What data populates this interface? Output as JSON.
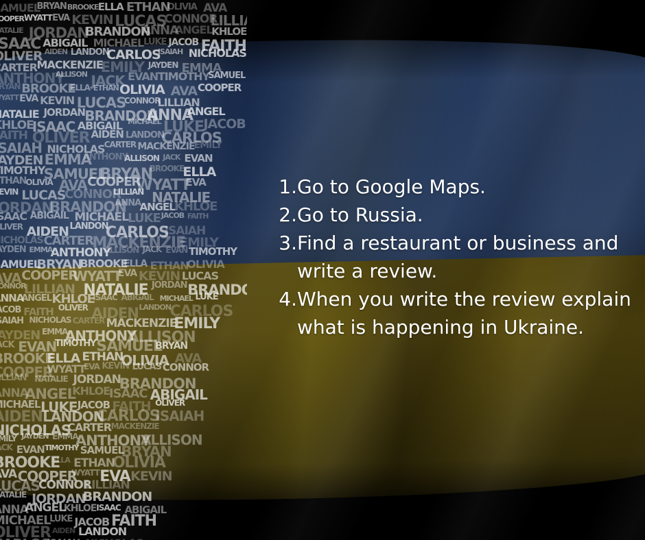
{
  "colors": {
    "flag_blue": "#1e3458",
    "flag_yellow": "#5a4d10",
    "text": "#ffffff"
  },
  "instructions": [
    {
      "number": "1.",
      "text": "Go to Google Maps."
    },
    {
      "number": "2.",
      "text": "Go to Russia."
    },
    {
      "number": "3.",
      "text": "Find a restaurant or business and write a review."
    },
    {
      "number": "4.",
      "text": "When you write the review explain what is happening in Ukraine."
    }
  ],
  "portrait_words": [
    "SAMUEL",
    "BRYAN",
    "BROOKE",
    "ELLA",
    "ETHAN",
    "OLIVIA",
    "AVA",
    "COOPER",
    "WYATT",
    "EVA",
    "KEVIN",
    "LUCAS",
    "CONNOR",
    "LILLIAN",
    "NATALIE",
    "JORDAN",
    "BRANDON",
    "ANNA",
    "ANGEL",
    "KHLOE",
    "ISAAC",
    "ABIGAIL",
    "MICHAEL",
    "LUKE",
    "JACOB",
    "FAITH",
    "OLIVER",
    "AIDEN",
    "LANDON",
    "CARLOS",
    "ISAIAH",
    "NICHOLAS",
    "CARTER",
    "MACKENZIE",
    "EMILY",
    "JAYDEN",
    "EMMA",
    "ANTHONY",
    "ALLISON",
    "JACK",
    "EVAN",
    "TIMOTHY"
  ]
}
